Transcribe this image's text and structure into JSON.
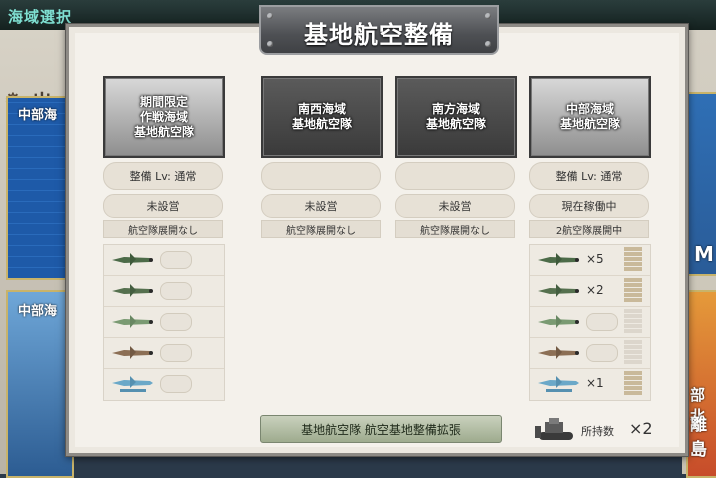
{
  "scene": {
    "top_title": "海域選択",
    "left_heading": "出",
    "left_map_labels": [
      "中部海",
      "中部海"
    ],
    "right_texts": [
      "M",
      "部北",
      "離島"
    ]
  },
  "panel": {
    "title": "基地航空整備",
    "columns": [
      {
        "banner": "期間限定\n作戦海域\n基地航空隊",
        "style": "light",
        "level": "整備 Lv: 通常",
        "status": "未設営",
        "deploy": "航空隊展開なし",
        "slots": [
          {
            "plane": "green-fighter",
            "count": ""
          },
          {
            "plane": "green-fighter",
            "count": ""
          },
          {
            "plane": "green-fighter-light",
            "count": ""
          },
          {
            "plane": "brown-bomber",
            "count": ""
          },
          {
            "plane": "seaplane",
            "count": ""
          }
        ]
      },
      {
        "banner": "南西海域\n基地航空隊",
        "style": "dark",
        "level": "",
        "status": "未設営",
        "deploy": "航空隊展開なし"
      },
      {
        "banner": "南方海域\n基地航空隊",
        "style": "dark",
        "level": "",
        "status": "未設営",
        "deploy": "航空隊展開なし"
      },
      {
        "banner": "中部海域\n基地航空隊",
        "style": "light",
        "level": "整備 Lv: 通常",
        "status": "現在稼働中",
        "deploy": "2航空隊展開中",
        "slots": [
          {
            "plane": "green-fighter",
            "count": "×5",
            "stock": 4
          },
          {
            "plane": "green-fighter",
            "count": "×2",
            "stock": 4
          },
          {
            "plane": "green-fighter-light",
            "count": "",
            "stock": 0
          },
          {
            "plane": "brown-bomber",
            "count": "",
            "stock": 0
          },
          {
            "plane": "seaplane",
            "count": "×1",
            "stock": 2
          }
        ]
      }
    ],
    "expand_button": "基地航空隊 航空基地整備拡張",
    "owned_label": "所持数",
    "owned_count": "×2"
  }
}
